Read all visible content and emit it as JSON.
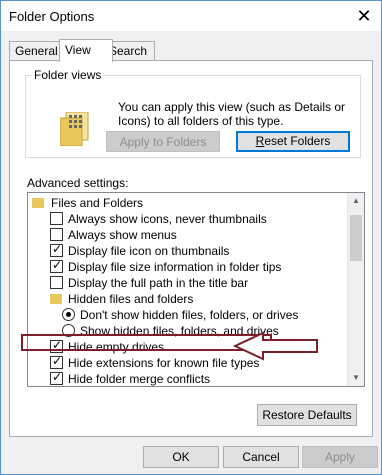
{
  "window": {
    "title": "Folder Options"
  },
  "tabs": [
    {
      "label": "General"
    },
    {
      "label": "View"
    },
    {
      "label": "Search"
    }
  ],
  "folder_views": {
    "title": "Folder views",
    "description": "You can apply this view (such as Details or Icons) to all folders of this type.",
    "apply_button": "Apply to Folders",
    "reset_button": "Reset Folders",
    "reset_button_accel": "R"
  },
  "advanced": {
    "label": "Advanced settings:",
    "items": [
      {
        "kind": "folder",
        "label": "Files and Folders"
      },
      {
        "kind": "checkbox",
        "checked": false,
        "label": "Always show icons, never thumbnails"
      },
      {
        "kind": "checkbox",
        "checked": false,
        "label": "Always show menus"
      },
      {
        "kind": "checkbox",
        "checked": true,
        "label": "Display file icon on thumbnails"
      },
      {
        "kind": "checkbox",
        "checked": true,
        "label": "Display file size information in folder tips"
      },
      {
        "kind": "checkbox",
        "checked": false,
        "label": "Display the full path in the title bar"
      },
      {
        "kind": "folder",
        "label": "Hidden files and folders"
      },
      {
        "kind": "radio",
        "checked": true,
        "label": "Don't show hidden files, folders, or drives"
      },
      {
        "kind": "radio",
        "checked": false,
        "label": "Show hidden files, folders, and drives"
      },
      {
        "kind": "checkbox",
        "checked": true,
        "label": "Hide empty drives"
      },
      {
        "kind": "checkbox",
        "checked": true,
        "label": "Hide extensions for known file types"
      },
      {
        "kind": "checkbox",
        "checked": true,
        "label": "Hide folder merge conflicts"
      }
    ]
  },
  "restore_button": "Restore Defaults",
  "footer": {
    "ok": "OK",
    "cancel": "Cancel",
    "apply": "Apply"
  },
  "annotation_color": "#7b1f2a"
}
